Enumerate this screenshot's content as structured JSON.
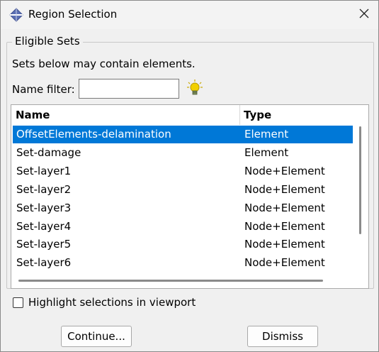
{
  "window": {
    "title": "Region Selection",
    "app_icon": "abaqus-diamond-icon",
    "close_icon": "close-icon"
  },
  "group": {
    "legend": "Eligible Sets",
    "description": "Sets below may contain elements.",
    "filter_label": "Name filter:",
    "filter_value": "",
    "filter_icon": "lightbulb-icon"
  },
  "table": {
    "columns": [
      "Name",
      "Type"
    ],
    "rows": [
      {
        "name": "OffsetElements-delamination",
        "type": "Element",
        "selected": true
      },
      {
        "name": "Set-damage",
        "type": "Element",
        "selected": false
      },
      {
        "name": "Set-layer1",
        "type": "Node+Element",
        "selected": false
      },
      {
        "name": "Set-layer2",
        "type": "Node+Element",
        "selected": false
      },
      {
        "name": "Set-layer3",
        "type": "Node+Element",
        "selected": false
      },
      {
        "name": "Set-layer4",
        "type": "Node+Element",
        "selected": false
      },
      {
        "name": "Set-layer5",
        "type": "Node+Element",
        "selected": false
      },
      {
        "name": "Set-layer6",
        "type": "Node+Element",
        "selected": false
      }
    ]
  },
  "highlight": {
    "label": "Highlight selections in viewport",
    "checked": false
  },
  "buttons": {
    "continue": "Continue...",
    "dismiss": "Dismiss"
  },
  "colors": {
    "selection": "#0078d7",
    "bulb": "#f2d000"
  }
}
